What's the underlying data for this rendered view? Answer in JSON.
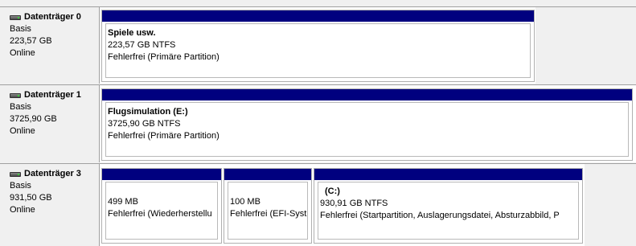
{
  "disks": [
    {
      "name": "Datenträger 0",
      "type": "Basis",
      "size": "223,57 GB",
      "status": "Online",
      "partitions": [
        {
          "name": "Spiele usw.",
          "size": "223,57 GB NTFS",
          "state": "Fehlerfrei (Primäre Partition)"
        }
      ]
    },
    {
      "name": "Datenträger 1",
      "type": "Basis",
      "size": "3725,90 GB",
      "status": "Online",
      "partitions": [
        {
          "name": "Flugsimulation  (E:)",
          "size": "3725,90 GB NTFS",
          "state": "Fehlerfrei (Primäre Partition)"
        }
      ]
    },
    {
      "name": "Datenträger 3",
      "type": "Basis",
      "size": "931,50 GB",
      "status": "Online",
      "partitions": [
        {
          "name": "",
          "size": "499 MB",
          "state": "Fehlerfrei (Wiederherstellu"
        },
        {
          "name": "",
          "size": "100 MB",
          "state": "Fehlerfrei (EFI-Syst"
        },
        {
          "name": "(C:)",
          "size": "930,91 GB NTFS",
          "state": "Fehlerfrei (Startpartition, Auslagerungsdatei, Absturzabbild, P"
        }
      ]
    }
  ],
  "colors": {
    "partition_bar": "#00007f",
    "background": "#f0f0f0"
  }
}
